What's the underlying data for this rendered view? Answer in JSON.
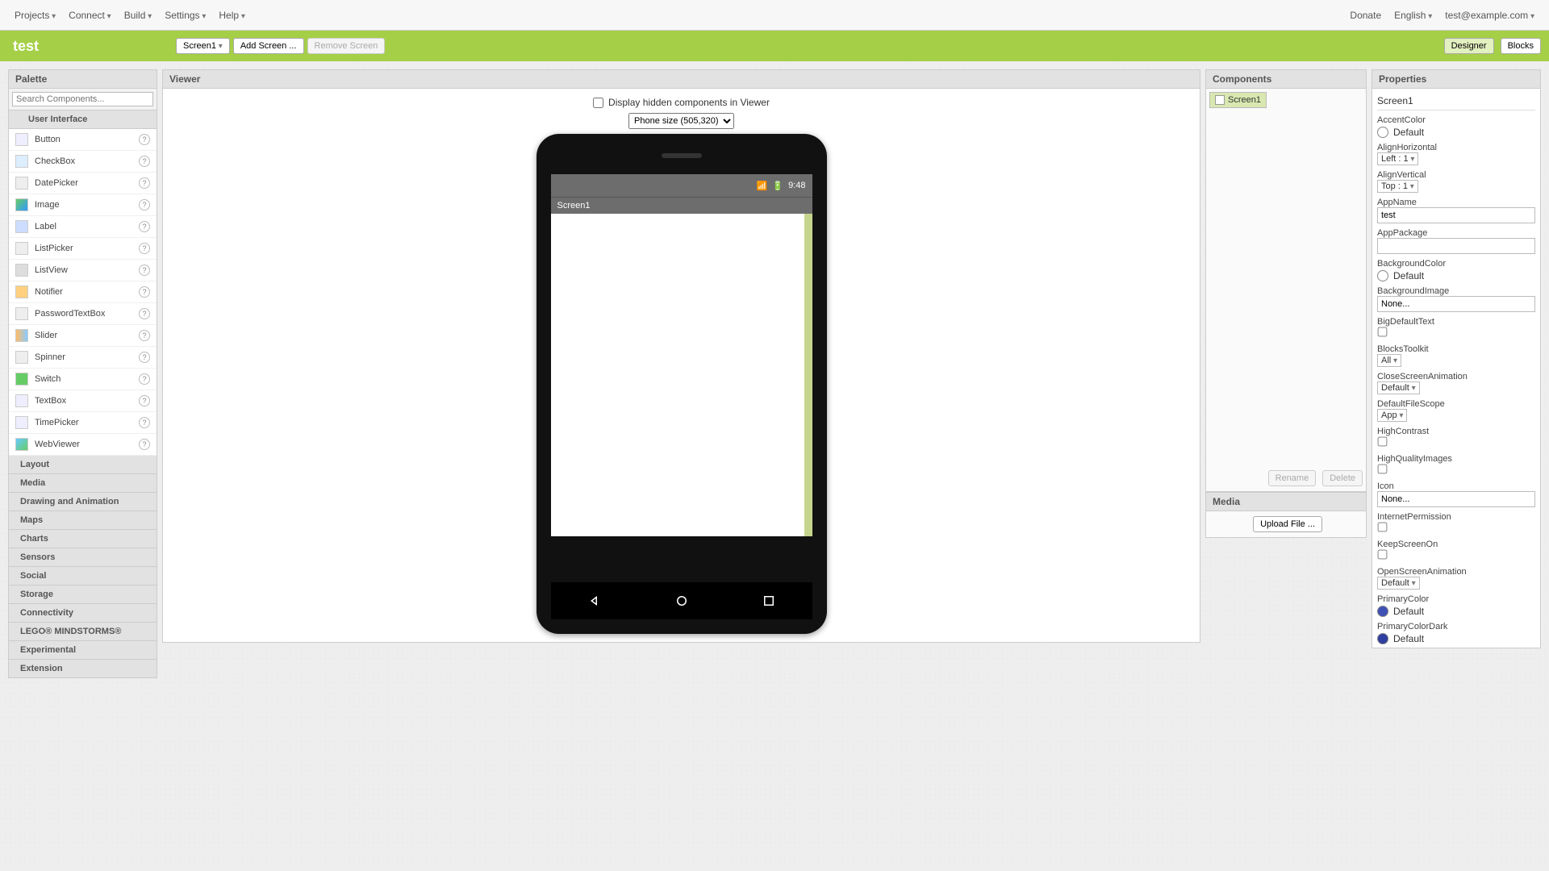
{
  "topbar": {
    "menus": [
      "Projects",
      "Connect",
      "Build",
      "Settings",
      "Help"
    ],
    "donate": "Donate",
    "lang": "English",
    "account": "test@example.com"
  },
  "greenbar": {
    "project": "test",
    "screen_dd": "Screen1",
    "add_screen": "Add Screen ...",
    "remove_screen": "Remove Screen",
    "designer": "Designer",
    "blocks": "Blocks"
  },
  "palette": {
    "title": "Palette",
    "search_placeholder": "Search Components...",
    "open_cat": "User Interface",
    "components": [
      {
        "name": "Button",
        "ic": "ic-button"
      },
      {
        "name": "CheckBox",
        "ic": "ic-check"
      },
      {
        "name": "DatePicker",
        "ic": "ic-date"
      },
      {
        "name": "Image",
        "ic": "ic-img"
      },
      {
        "name": "Label",
        "ic": "ic-label"
      },
      {
        "name": "ListPicker",
        "ic": "ic-list"
      },
      {
        "name": "ListView",
        "ic": "ic-view"
      },
      {
        "name": "Notifier",
        "ic": "ic-notif"
      },
      {
        "name": "PasswordTextBox",
        "ic": "ic-pwd"
      },
      {
        "name": "Slider",
        "ic": "ic-slider"
      },
      {
        "name": "Spinner",
        "ic": "ic-spin"
      },
      {
        "name": "Switch",
        "ic": "ic-switch"
      },
      {
        "name": "TextBox",
        "ic": "ic-text"
      },
      {
        "name": "TimePicker",
        "ic": "ic-time"
      },
      {
        "name": "WebViewer",
        "ic": "ic-web"
      }
    ],
    "categories": [
      "Layout",
      "Media",
      "Drawing and Animation",
      "Maps",
      "Charts",
      "Sensors",
      "Social",
      "Storage",
      "Connectivity",
      "LEGO® MINDSTORMS®",
      "Experimental",
      "Extension"
    ]
  },
  "viewer": {
    "title": "Viewer",
    "hidden_label": "Display hidden components in Viewer",
    "size_select": "Phone size (505,320)",
    "phone_time": "9:48",
    "screen_title": "Screen1"
  },
  "components": {
    "title": "Components",
    "root": "Screen1",
    "rename": "Rename",
    "delete": "Delete"
  },
  "media": {
    "title": "Media",
    "upload": "Upload File ..."
  },
  "properties": {
    "title": "Properties",
    "screen": "Screen1",
    "items": {
      "AccentColor": {
        "label": "AccentColor",
        "value": "Default",
        "color": "#e91e63"
      },
      "AlignHorizontal": {
        "label": "AlignHorizontal",
        "value": "Left : 1"
      },
      "AlignVertical": {
        "label": "AlignVertical",
        "value": "Top : 1"
      },
      "AppName": {
        "label": "AppName",
        "value": "test"
      },
      "AppPackage": {
        "label": "AppPackage",
        "value": ""
      },
      "BackgroundColor": {
        "label": "BackgroundColor",
        "value": "Default",
        "color": "#ffffff"
      },
      "BackgroundImage": {
        "label": "BackgroundImage",
        "value": "None..."
      },
      "BigDefaultText": {
        "label": "BigDefaultText",
        "checked": false
      },
      "BlocksToolkit": {
        "label": "BlocksToolkit",
        "value": "All"
      },
      "CloseScreenAnimation": {
        "label": "CloseScreenAnimation",
        "value": "Default"
      },
      "DefaultFileScope": {
        "label": "DefaultFileScope",
        "value": "App"
      },
      "HighContrast": {
        "label": "HighContrast",
        "checked": false
      },
      "HighQualityImages": {
        "label": "HighQualityImages",
        "checked": false
      },
      "Icon": {
        "label": "Icon",
        "value": "None..."
      },
      "InternetPermission": {
        "label": "InternetPermission",
        "checked": false
      },
      "KeepScreenOn": {
        "label": "KeepScreenOn",
        "checked": false
      },
      "OpenScreenAnimation": {
        "label": "OpenScreenAnimation",
        "value": "Default"
      },
      "PrimaryColor": {
        "label": "PrimaryColor",
        "value": "Default",
        "color": "#3f51b5"
      },
      "PrimaryColorDark": {
        "label": "PrimaryColorDark",
        "value": "Default",
        "color": "#303f9f"
      }
    }
  }
}
